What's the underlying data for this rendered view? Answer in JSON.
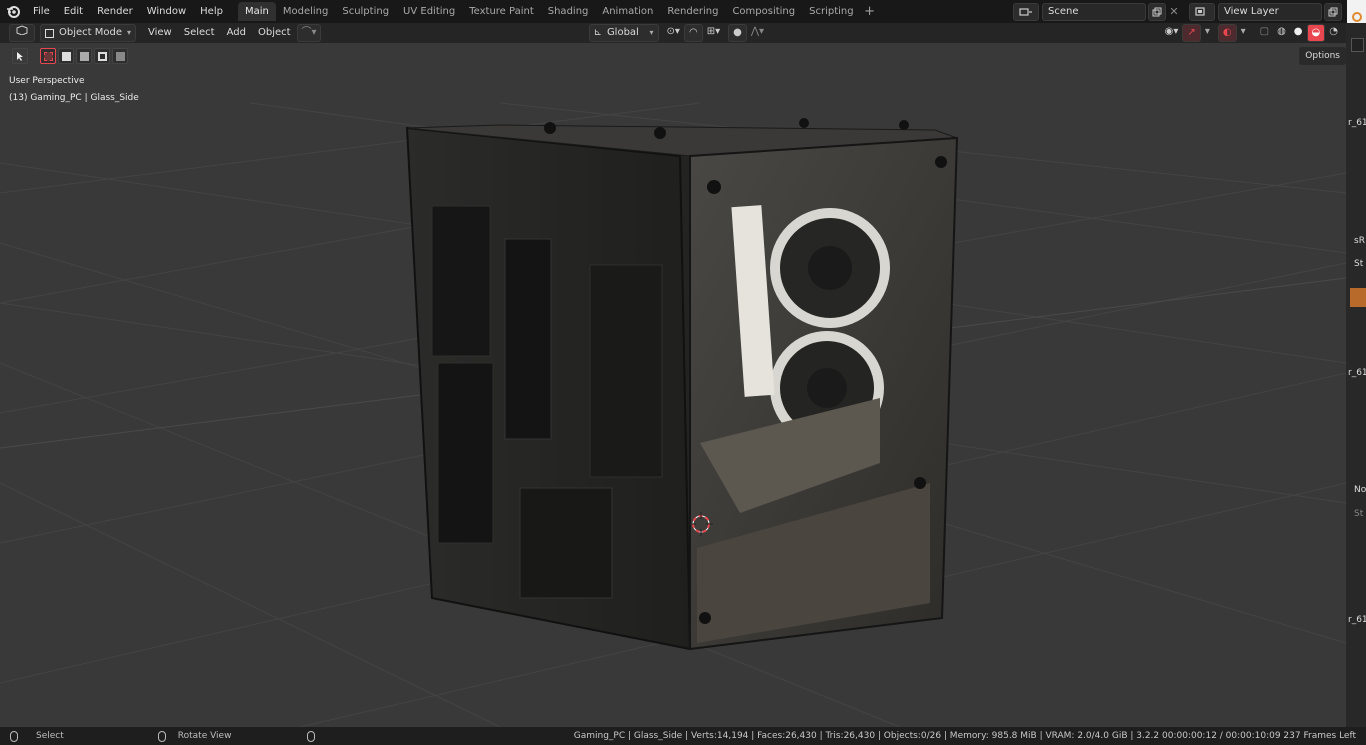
{
  "menu": [
    "File",
    "Edit",
    "Render",
    "Window",
    "Help"
  ],
  "workspaces": [
    "Main",
    "Modeling",
    "Sculpting",
    "UV Editing",
    "Texture Paint",
    "Shading",
    "Animation",
    "Rendering",
    "Compositing",
    "Scripting"
  ],
  "active_workspace": "Main",
  "add_tab_symbol": "+",
  "scene": {
    "name": "Scene"
  },
  "view_layer": {
    "name": "View Layer"
  },
  "header": {
    "mode": "Object Mode",
    "menus": [
      "View",
      "Select",
      "Add",
      "Object"
    ],
    "transform_orientation": "Global"
  },
  "viewport": {
    "perspective_label": "User Perspective",
    "object_label": "(13) Gaming_PC | Glass_Side",
    "options_label": "Options"
  },
  "right_strip_fragments": [
    "r_61",
    "sR",
    "St",
    "r_61",
    "No",
    "St",
    "r_61"
  ],
  "statusbar": {
    "select": "Select",
    "rotate": "Rotate View",
    "stats": "Gaming_PC | Glass_Side | Verts:14,194 | Faces:26,430 | Tris:26,430 | Objects:0/26 | Memory: 985.8 MiB | VRAM: 2.0/4.0 GiB | 3.2.2   00:00:00:12 / 00:00:10:09   237 Frames Left"
  },
  "colors": {
    "accent_red": "#e8474f",
    "active_tab": "#303030",
    "viewport_bg": "#393939"
  },
  "icons": [
    "blender-logo-icon",
    "editor-type-icon",
    "object-mode-icon",
    "orientation-icon",
    "pivot-icon",
    "snap-icon",
    "proportional-icon",
    "visibility-icon",
    "gizmo-icon",
    "overlay-icon",
    "xray-icon",
    "wireframe-shading-icon",
    "solid-shading-icon",
    "material-shading-icon",
    "rendered-shading-icon",
    "3d-cursor-icon"
  ]
}
